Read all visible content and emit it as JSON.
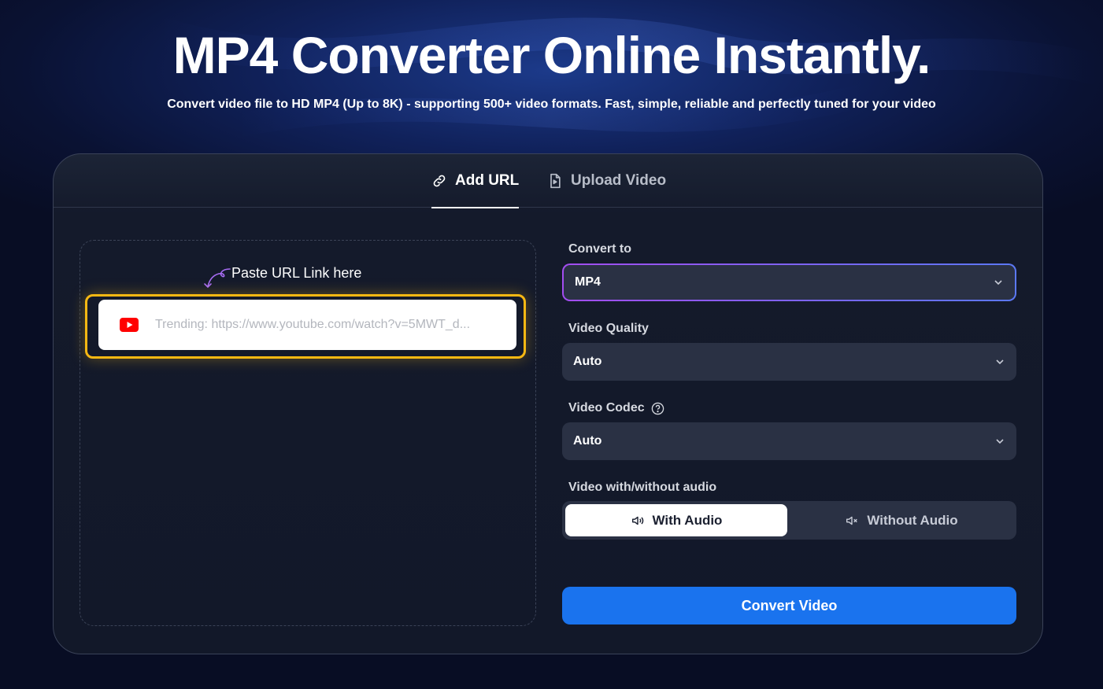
{
  "hero": {
    "title": "MP4 Converter Online Instantly.",
    "subtitle": "Convert video file to HD MP4 (Up to 8K) - supporting 500+ video formats. Fast, simple, reliable and perfectly tuned for your video"
  },
  "tabs": [
    {
      "label": "Add URL",
      "icon": "link-icon",
      "active": true
    },
    {
      "label": "Upload Video",
      "icon": "file-video-icon",
      "active": false
    }
  ],
  "url_panel": {
    "hint": "Paste URL Link here",
    "placeholder": "Trending: https://www.youtube.com/watch?v=5MWT_d...",
    "value": "",
    "source_icon": "youtube-icon",
    "highlight_color": "#f7b813"
  },
  "settings": {
    "convert_to": {
      "label": "Convert to",
      "value": "MP4"
    },
    "video_quality": {
      "label": "Video Quality",
      "value": "Auto"
    },
    "video_codec": {
      "label": "Video Codec",
      "value": "Auto",
      "help_icon": "question-circle-icon"
    },
    "audio": {
      "label": "Video with/without audio",
      "options": [
        {
          "label": "With Audio",
          "icon": "speaker-icon",
          "selected": true
        },
        {
          "label": "Without Audio",
          "icon": "speaker-mute-icon",
          "selected": false
        }
      ]
    }
  },
  "convert_button": {
    "label": "Convert Video",
    "color": "#1a73ee"
  },
  "colors": {
    "accent": "#1a73ee",
    "background": "#0a1233",
    "card": "#141a2b"
  }
}
